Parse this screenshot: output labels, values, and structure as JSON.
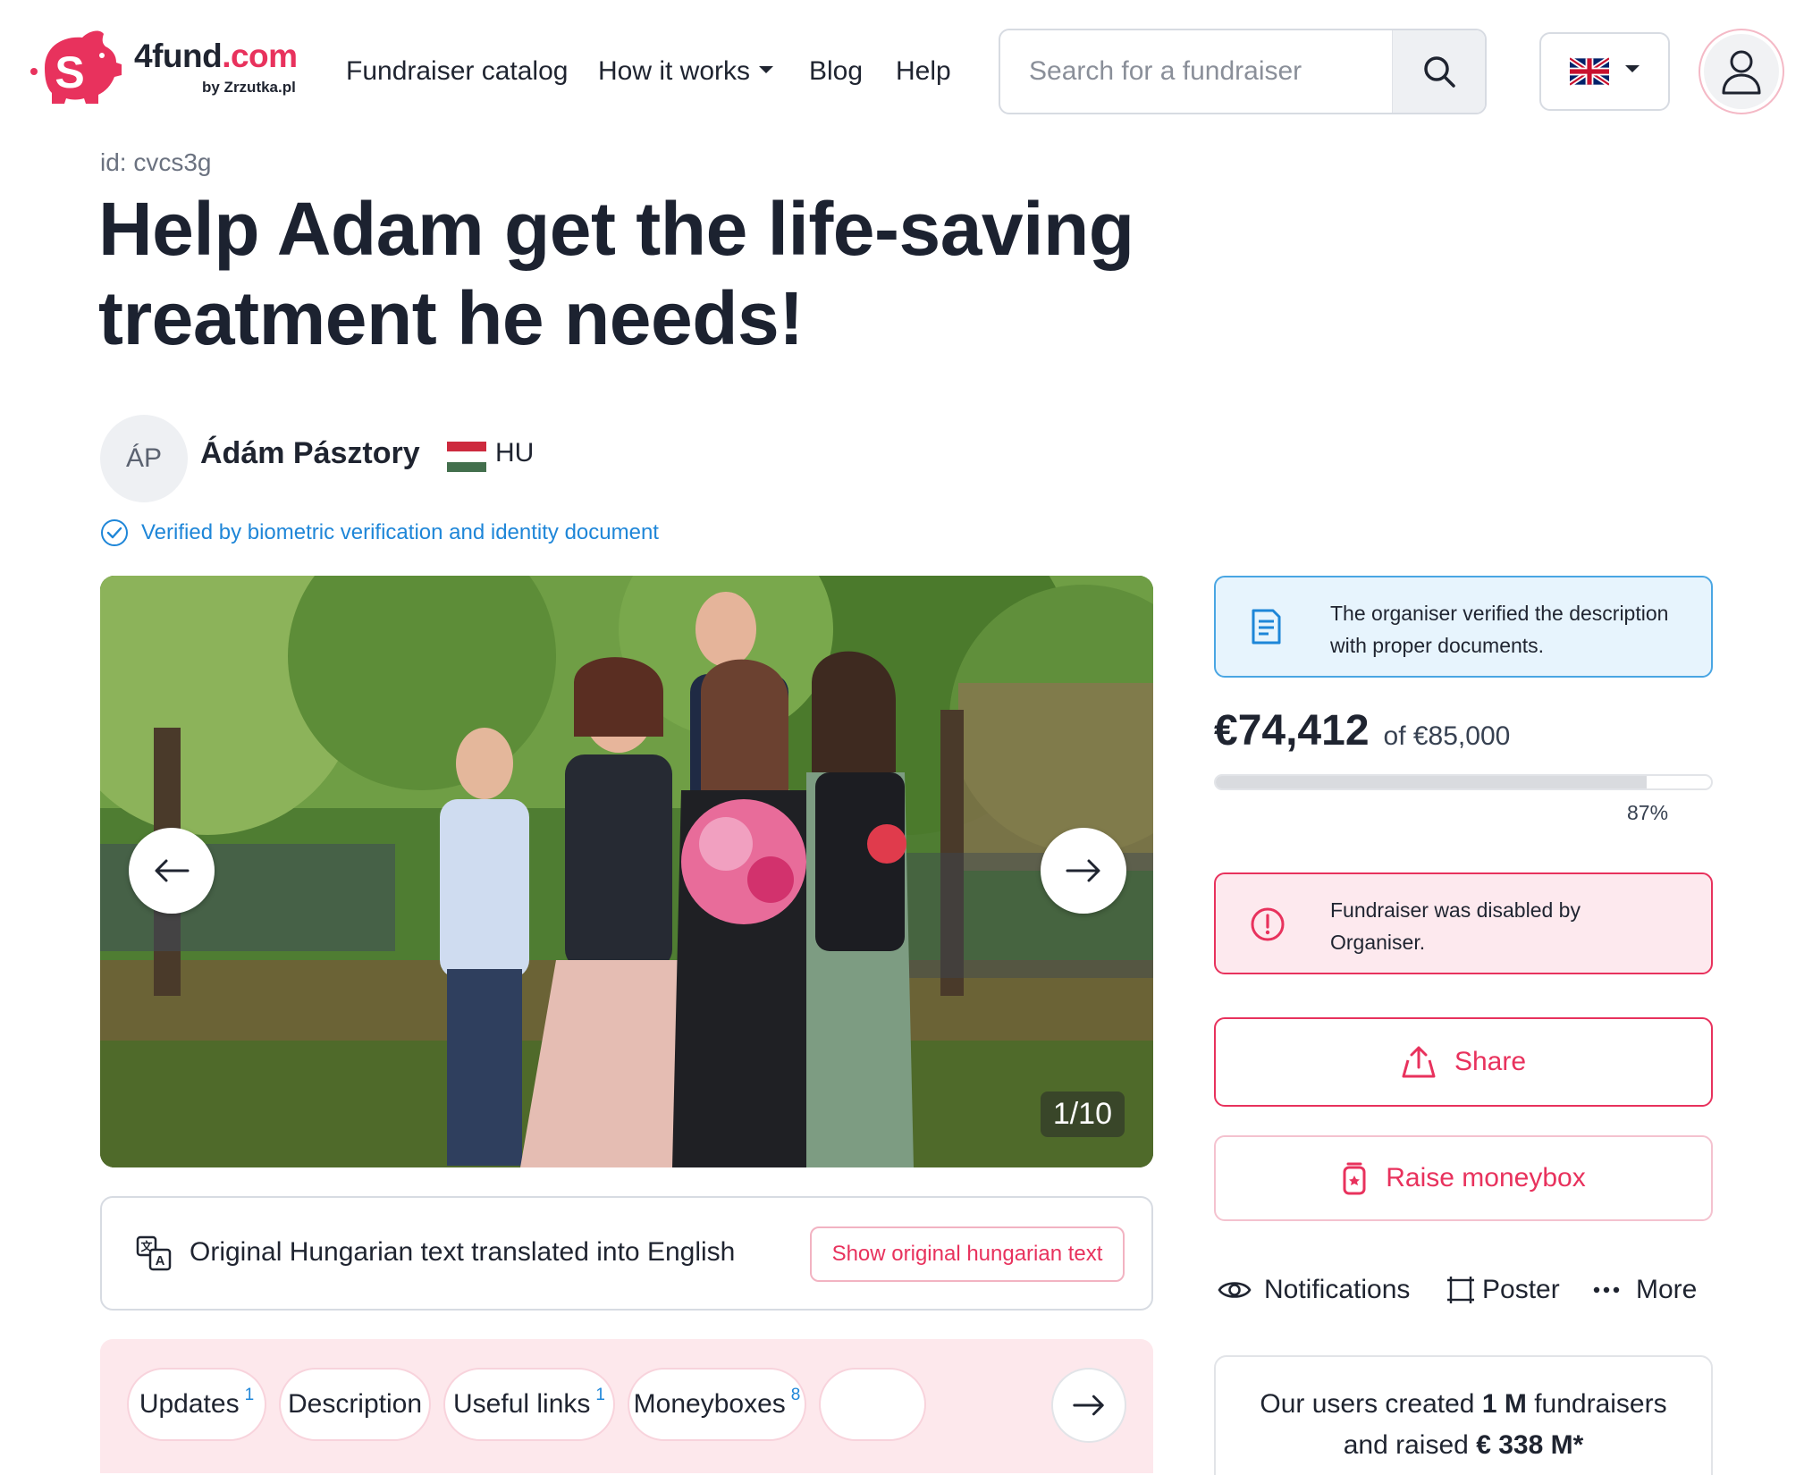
{
  "brand": {
    "name_main": "4fund",
    "name_domain": ".com",
    "by_line": "by Zrzutka.pl",
    "accent_color": "#e8325d"
  },
  "nav": {
    "catalog": "Fundraiser catalog",
    "how_it_works": "How it works",
    "blog": "Blog",
    "help": "Help"
  },
  "search": {
    "placeholder": "Search for a fundraiser",
    "icon": "search-icon"
  },
  "language": {
    "icon": "uk-flag-icon"
  },
  "account": {
    "icon": "user-icon"
  },
  "fundraiser": {
    "id_label": "id: cvcs3g",
    "title": "Help Adam get the life-saving treatment he needs!"
  },
  "organiser": {
    "initials": "ÁP",
    "name": "Ádám Pásztory",
    "country": "HU",
    "verified_text": "Verified by biometric verification and identity document"
  },
  "gallery": {
    "counter": "1/10",
    "prev_icon": "arrow-left-icon",
    "next_icon": "arrow-right-icon"
  },
  "translation": {
    "text": "Original Hungarian text translated into English",
    "button": "Show original hungarian text"
  },
  "tabs": [
    {
      "label": "Updates",
      "count": "1"
    },
    {
      "label": "Description",
      "count": ""
    },
    {
      "label": "Useful links",
      "count": "1"
    },
    {
      "label": "Moneyboxes",
      "count": "8"
    }
  ],
  "sidebar": {
    "doc_notice": "The organiser verified the description with proper documents.",
    "raised": "€74,412",
    "goal": "of €85,000",
    "progress_fraction": 0.87,
    "progress_label": "87%",
    "disabled_notice": "Fundraiser was disabled by Organiser.",
    "share_label": "Share",
    "moneybox_label": "Raise moneybox",
    "notifications_label": "Notifications",
    "poster_label": "Poster",
    "more_label": "More",
    "stats_prefix": "Our users created",
    "stats_fundraisers": "1 M",
    "stats_mid": "fundraisers",
    "stats_and": "and raised",
    "stats_amount": "€ 338 M*"
  }
}
